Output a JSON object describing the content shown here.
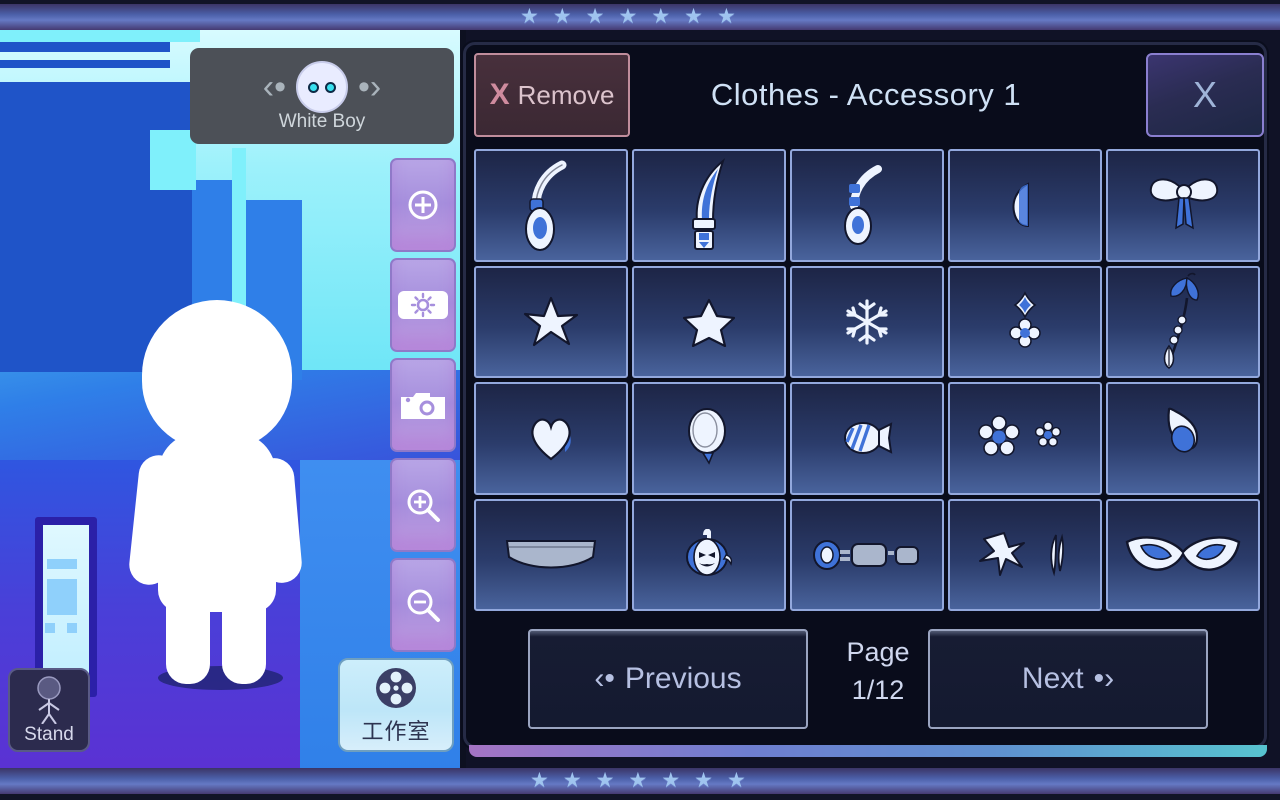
{
  "character_selector": {
    "prev_icon": "chevron-left-icon",
    "next_icon": "chevron-right-icon",
    "name": "White Boy"
  },
  "tools": [
    {
      "id": "add-target",
      "icon": "plus-circle-icon"
    },
    {
      "id": "brightness",
      "icon": "sun-icon"
    },
    {
      "id": "camera",
      "icon": "camera-icon"
    },
    {
      "id": "zoom-in",
      "icon": "zoom-in-icon"
    },
    {
      "id": "zoom-out",
      "icon": "zoom-out-icon"
    }
  ],
  "stand_button": {
    "label": "Stand",
    "icon": "pose-figure-icon"
  },
  "studio_button": {
    "label": "工作室",
    "icon": "film-reel-icon"
  },
  "wardrobe": {
    "remove": {
      "label": "Remove",
      "icon": "x-mark-icon"
    },
    "title": "Clothes - Accessory 1",
    "close": {
      "label": "X",
      "icon": "close-icon"
    },
    "items": [
      {
        "name": "headset-white",
        "icon": "headset-icon"
      },
      {
        "name": "blade-blue",
        "icon": "curved-blade-icon"
      },
      {
        "name": "headset-small",
        "icon": "headset-small-icon"
      },
      {
        "name": "half-moon",
        "icon": "half-moon-icon"
      },
      {
        "name": "bow-ribbon",
        "icon": "bow-icon"
      },
      {
        "name": "star-5point",
        "icon": "star-icon"
      },
      {
        "name": "star-chunky",
        "icon": "star-filled-icon"
      },
      {
        "name": "snowflake",
        "icon": "snowflake-icon"
      },
      {
        "name": "gem-flower-pair",
        "icon": "gem-flower-icon"
      },
      {
        "name": "butterfly-sprig",
        "icon": "butterfly-icon"
      },
      {
        "name": "heart",
        "icon": "heart-icon"
      },
      {
        "name": "balloon",
        "icon": "balloon-icon"
      },
      {
        "name": "wrapped-candy",
        "icon": "candy-icon"
      },
      {
        "name": "flower-pair",
        "icon": "flower-pair-icon"
      },
      {
        "name": "flame-drop",
        "icon": "flame-icon"
      },
      {
        "name": "headband",
        "icon": "headband-icon"
      },
      {
        "name": "pumpkin",
        "icon": "pumpkin-icon"
      },
      {
        "name": "bolt-device",
        "icon": "device-icon"
      },
      {
        "name": "sparkle-feather",
        "icon": "sparkle-icon"
      },
      {
        "name": "cat-eye-mask",
        "icon": "mask-icon"
      }
    ],
    "footer": {
      "previous_label": "Previous",
      "next_label": "Next",
      "page_word": "Page",
      "page_value": "1/12"
    }
  },
  "decor": {
    "star_glyph": "★",
    "top_star_count": 7,
    "bottom_star_count": 7
  },
  "colors": {
    "accent_purple": "#a68fdd",
    "panel_bg": "#090c1b",
    "cell_border": "#93a8dd",
    "remove_pink": "#cf8b9e",
    "title_blue": "#cfe1f5"
  }
}
